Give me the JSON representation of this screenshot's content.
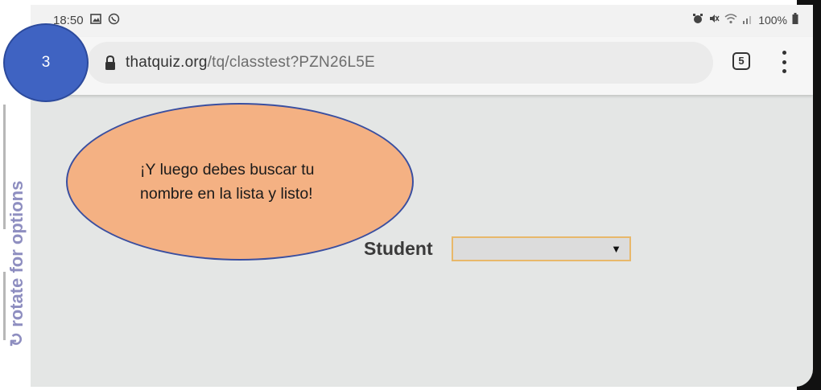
{
  "status_bar": {
    "time": "18:50",
    "battery": "100%",
    "left_icons": [
      "image-icon",
      "whatsapp-icon"
    ],
    "right_icons": [
      "alarm-icon",
      "mute-icon",
      "wifi-icon",
      "signal-icon",
      "battery-icon"
    ]
  },
  "browser": {
    "url_domain": "thatquiz.org",
    "url_path": "/tq/classtest?PZN26L5E",
    "tab_count": "5"
  },
  "page": {
    "side_tab_label": "rotate for options",
    "student_label": "Student",
    "student_select_value": ""
  },
  "annotation": {
    "step_number": "3",
    "instruction": "¡Y luego debes buscar tu nombre en la lista y listo!"
  },
  "colors": {
    "page_bg": "#e4e6e5",
    "side_tab_text": "#8e8ec0",
    "select_border": "#e8b86a",
    "bubble_blue": "#3f63c2",
    "oval_fill": "#f4b183",
    "oval_border": "#3a4fa0"
  }
}
